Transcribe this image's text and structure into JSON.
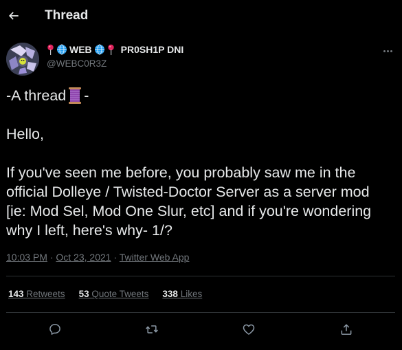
{
  "header": {
    "title": "Thread"
  },
  "author": {
    "name_text": "WEB",
    "name_suffix": "PR0SH1P DNI",
    "handle": "@WEBC0R3Z"
  },
  "tweet": {
    "line1_pre": "-A thread",
    "line1_post": " -",
    "line2": "Hello,",
    "line3": "If you've seen me before, you probably saw me in the official Dolleye / Twisted-Doctor Server as a server mod [ie: Mod Sel, Mod One Slur, etc] and if you're wondering why I left, here's why- 1/?"
  },
  "meta": {
    "time": "10:03 PM",
    "sep1": " · ",
    "date": "Oct 23, 2021",
    "sep2": " · ",
    "source": "Twitter Web App"
  },
  "stats": {
    "retweets_count": "143",
    "retweets_label": " Retweets",
    "quotes_count": "53",
    "quotes_label": " Quote Tweets",
    "likes_count": "338",
    "likes_label": " Likes"
  },
  "colors": {
    "background": "#000000",
    "text": "#e7e9ea",
    "secondary": "#71767b",
    "divider": "#2f3336"
  },
  "icons": [
    "back-arrow-icon",
    "pin-icon",
    "globe-icon",
    "more-icon",
    "spool-icon",
    "reply-icon",
    "retweet-icon",
    "like-icon",
    "share-icon"
  ]
}
